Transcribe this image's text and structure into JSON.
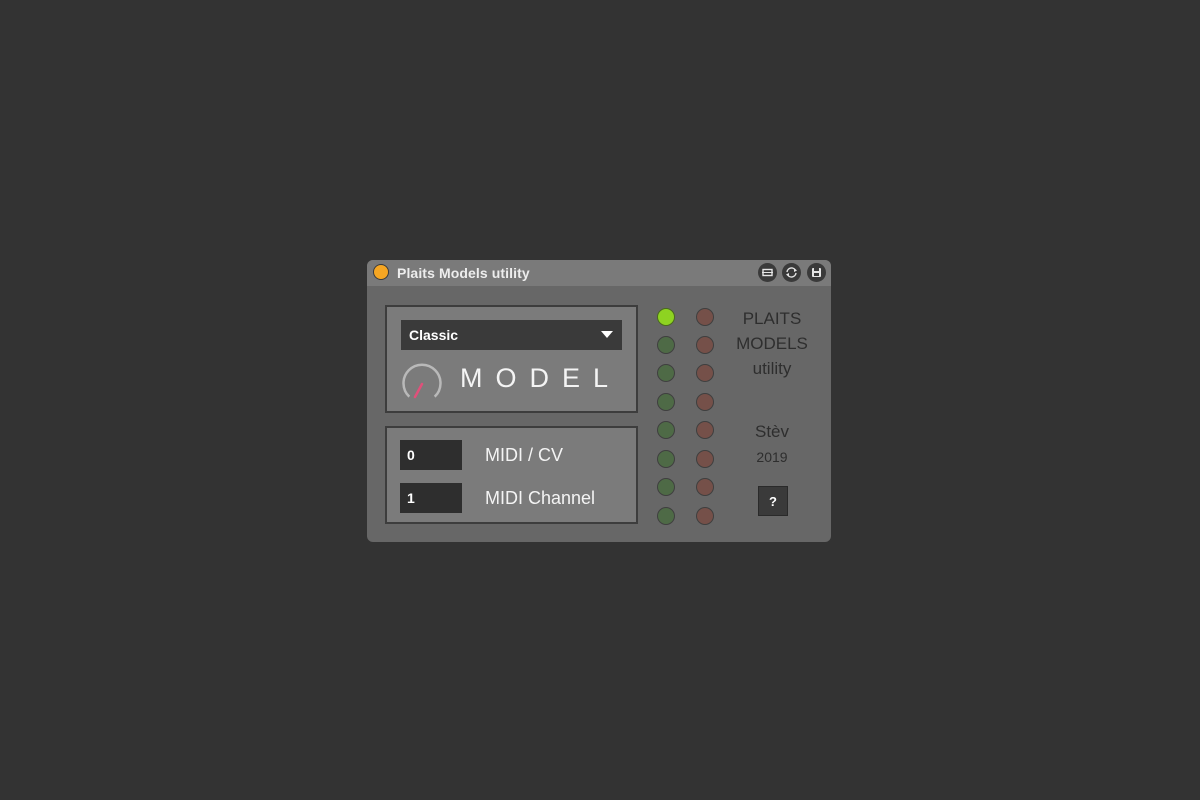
{
  "device": {
    "title": "Plaits Models utility",
    "power_on": true,
    "buttons": [
      "map-icon",
      "refresh-icon",
      "save-icon"
    ]
  },
  "model_panel": {
    "dropdown_value": "Classic",
    "knob_label": "MODEL"
  },
  "midi_panel": {
    "cv_value": "0",
    "cv_label": "MIDI / CV",
    "channel_value": "1",
    "channel_label": "MIDI Channel"
  },
  "leds": {
    "active_index": 0,
    "green_color": "#4e6a46",
    "green_active_color": "#8ed321",
    "red_color": "#755049"
  },
  "info": {
    "line1": "PLAITS",
    "line2": "MODELS",
    "line3": "utility",
    "author": "Stèv",
    "year": "2019",
    "help_label": "?"
  },
  "colors": {
    "background": "#333333",
    "device_body": "#676767",
    "titlebar": "#7a7a7a",
    "power": "#f5a623",
    "knob_indicator": "#e0507a"
  }
}
